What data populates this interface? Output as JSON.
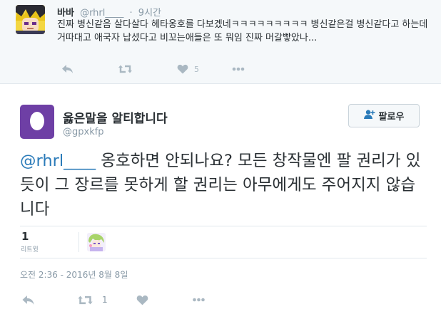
{
  "reply": {
    "name": "바바",
    "handle": "@rhrl____",
    "separator": "·",
    "time": "9시간",
    "text": "진짜 병신같음 살다살다 헤타옹호를 다보겠네ㅋㅋㅋㅋㅋㅋㅋㅋㅋ 병신같은걸 병신같다고 하는데 거따대고 애국자 납셨다고 비꼬는애들은 또 뭐임 진짜 머갈빻았나...",
    "like_count": "5"
  },
  "tweet": {
    "name": "옳은말을 알티합니다",
    "handle": "@gpxkfp",
    "follow_label": "팔로우",
    "mention": "@rhrl____",
    "text": " 옹호하면 안되나요? 모든 창작물엔 팔 권리가 있듯이 그 장르를 못하게 할 권리는 아무에게도 주어지지 않습니다",
    "retweet_count": "1",
    "retweet_label": "리트윗",
    "timestamp": "오전 2:36 - 2016년 8월 8일",
    "action_retweet_count": "1"
  },
  "icons": {
    "reply": "reply-icon",
    "retweet": "retweet-icon",
    "like": "heart-icon",
    "more": "more-icon",
    "follow": "add-user-icon"
  },
  "colors": {
    "link": "#2b7bb9",
    "muted": "#8899a6",
    "icon": "#aab8c2",
    "reply_bg": "#f5f8fa",
    "avatar_purple": "#6e3fa5"
  }
}
